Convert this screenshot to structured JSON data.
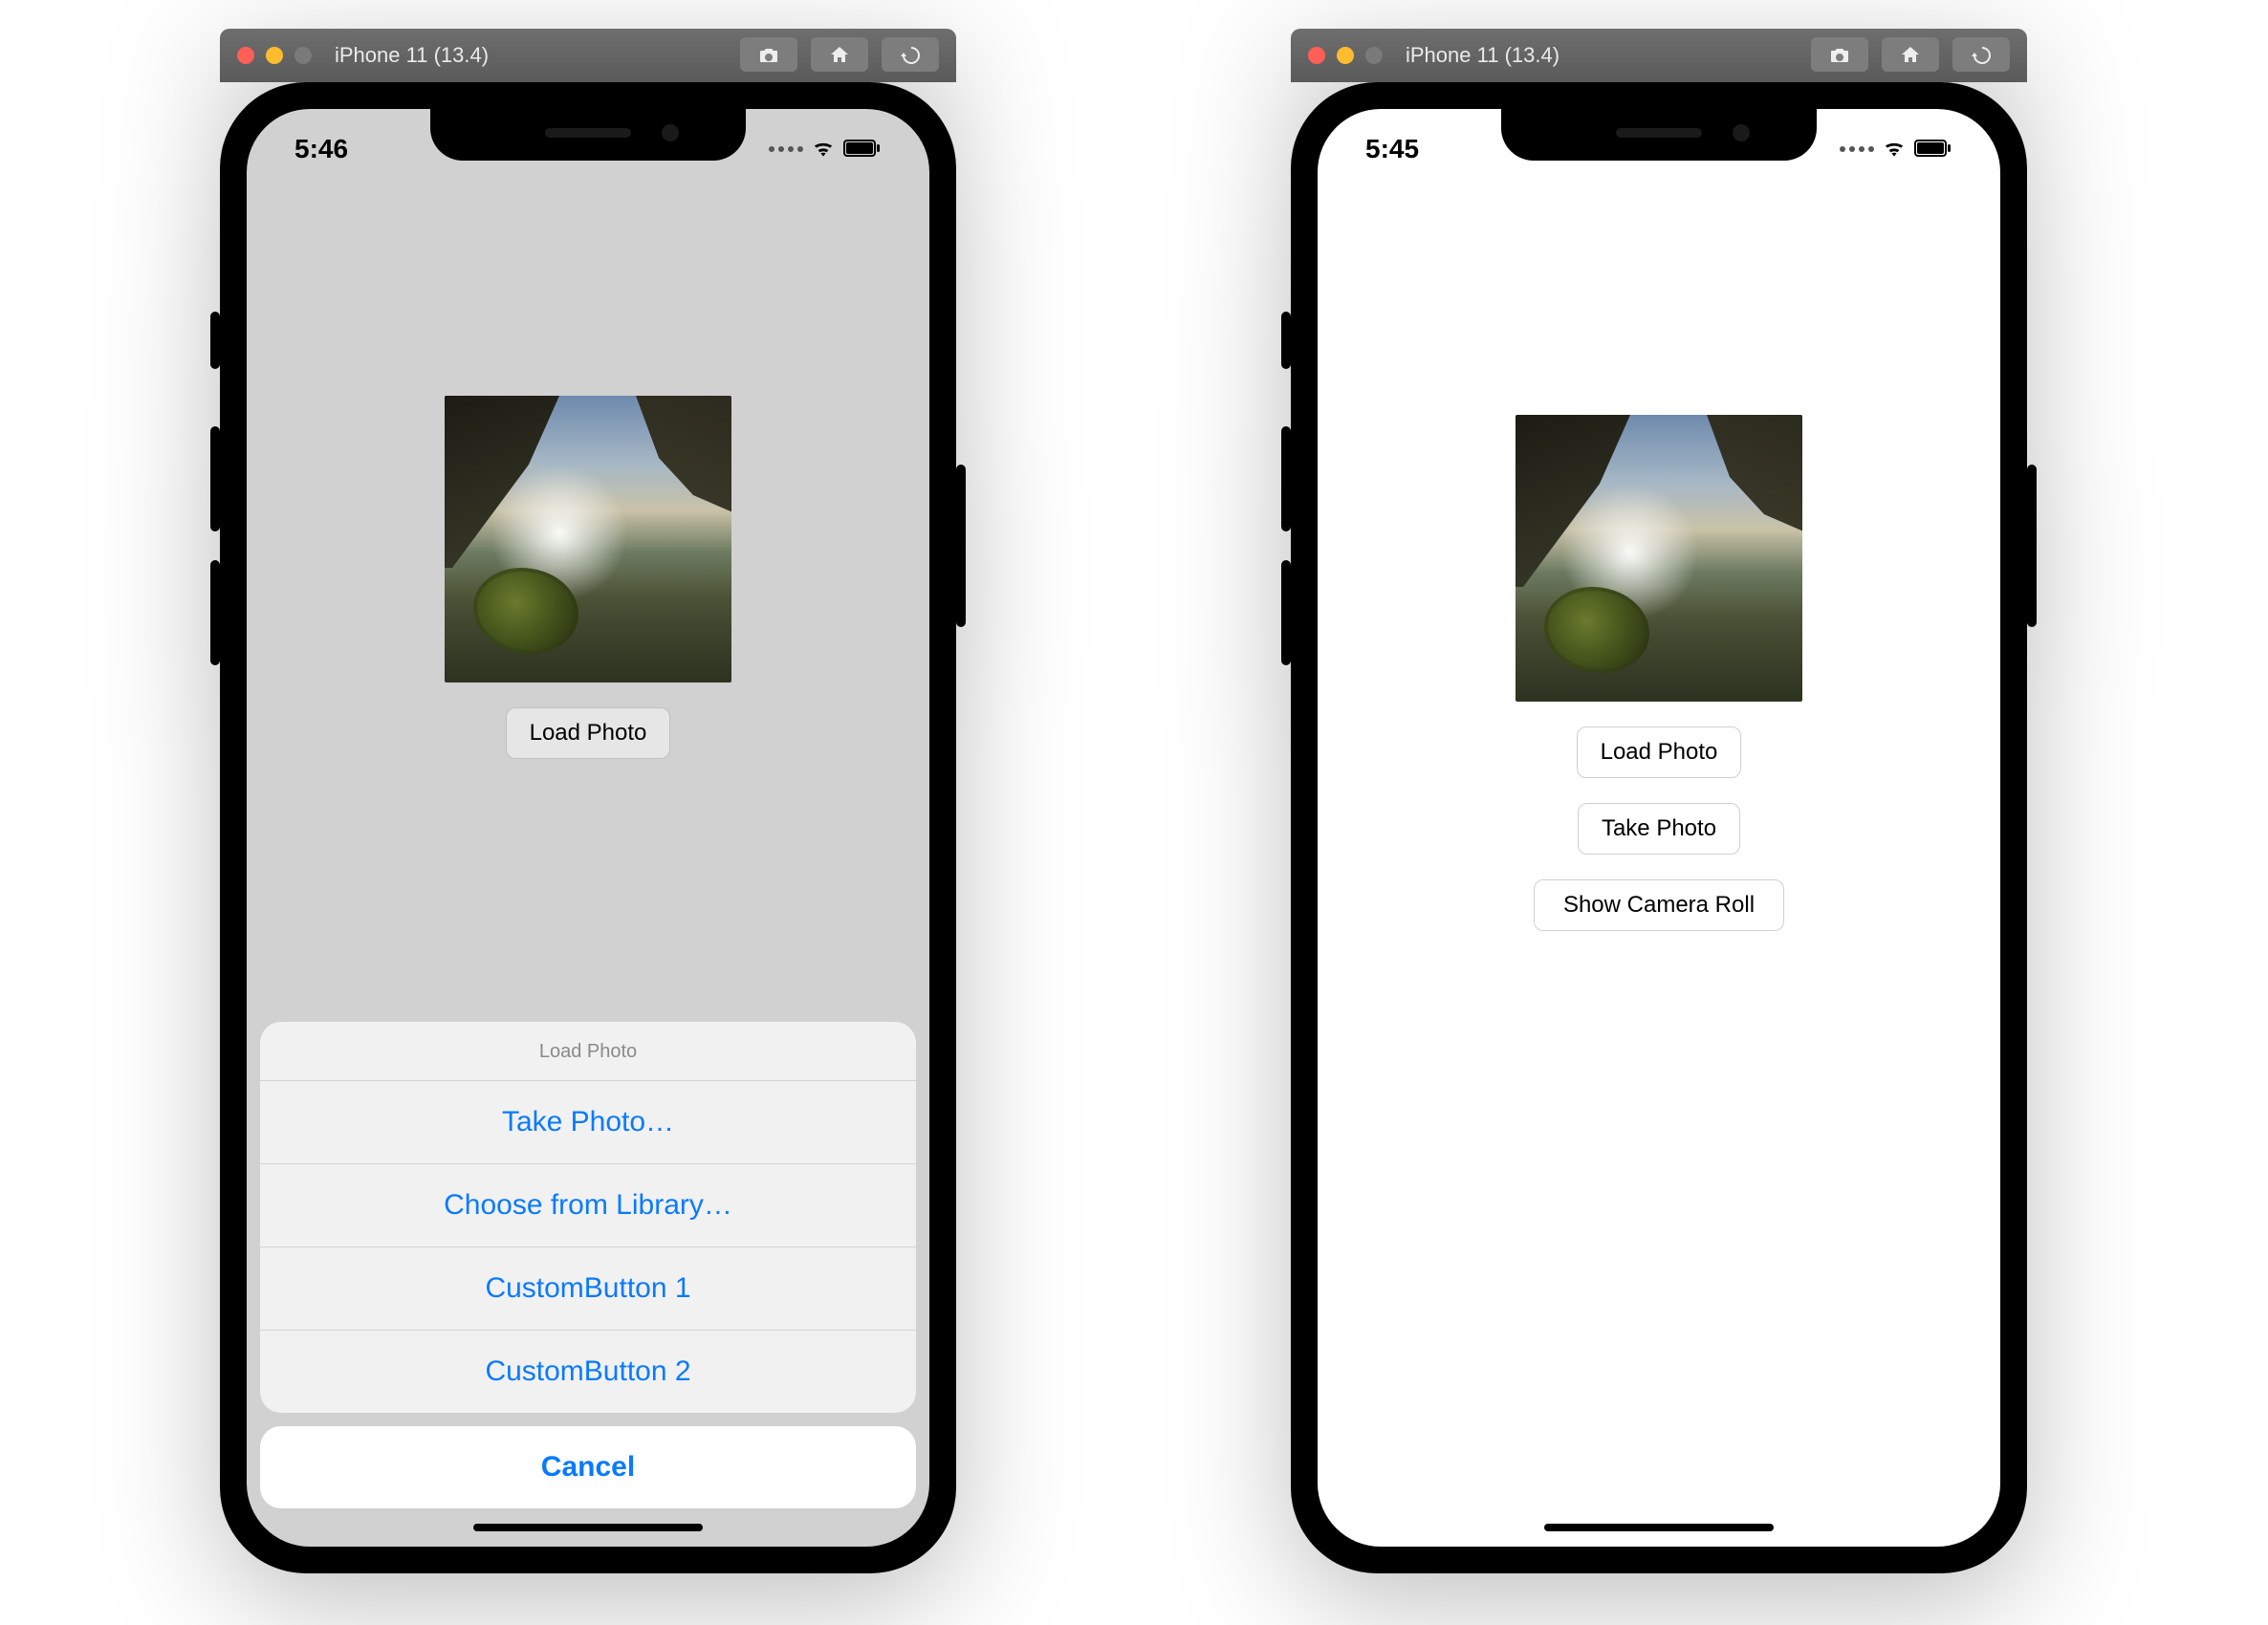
{
  "left": {
    "toolbar_title": "iPhone 11 (13.4)",
    "status_time": "5:46",
    "load_button": "Load Photo",
    "sheet": {
      "title": "Load Photo",
      "take_photo": "Take Photo…",
      "choose_library": "Choose from Library…",
      "custom1": "CustomButton 1",
      "custom2": "CustomButton 2",
      "cancel": "Cancel"
    }
  },
  "right": {
    "toolbar_title": "iPhone 11 (13.4)",
    "status_time": "5:45",
    "load_button": "Load Photo",
    "take_button": "Take Photo",
    "roll_button": "Show Camera Roll"
  }
}
